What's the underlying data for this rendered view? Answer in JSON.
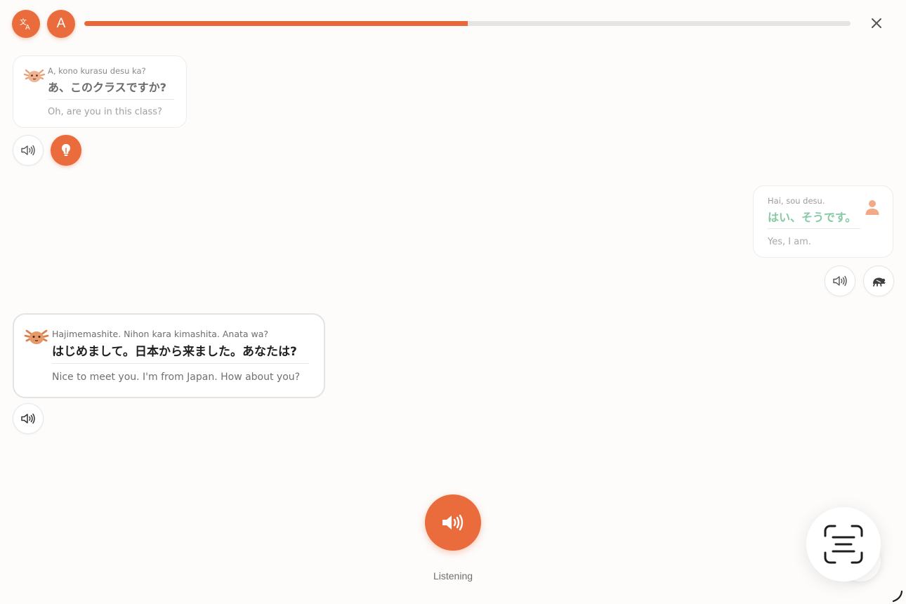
{
  "header": {
    "translate_icon": "translate-icon",
    "letter_button_label": "A",
    "progress": 0.5,
    "close_icon": "close-icon",
    "accent_color": "#ea6c3d"
  },
  "messages": [
    {
      "speaker": "axolotl",
      "romaji": "A, kono kurasu desu ka?",
      "japanese": "あ、このクラスですか?",
      "english": "Oh, are you in this class?",
      "actions": [
        "speaker-icon",
        "hint-bulb-icon"
      ]
    },
    {
      "speaker": "user",
      "romaji": "Hai, sou desu.",
      "japanese": "はい、そうです。",
      "english": "Yes, I am.",
      "japanese_color": "#86c9a2",
      "actions": [
        "speaker-icon",
        "slow-playback-icon"
      ]
    },
    {
      "speaker": "axolotl",
      "romaji": "Hajimemashite. Nihon kara kimashita. Anata wa?",
      "japanese": "はじめまして。日本から来ました。あなたは?",
      "english": "Nice to meet you. I'm from Japan. How about you?",
      "actions": [
        "speaker-icon"
      ]
    }
  ],
  "footer": {
    "listen_icon": "speaker-icon",
    "status_label": "Listening",
    "scan_icon": "text-scan-icon"
  }
}
